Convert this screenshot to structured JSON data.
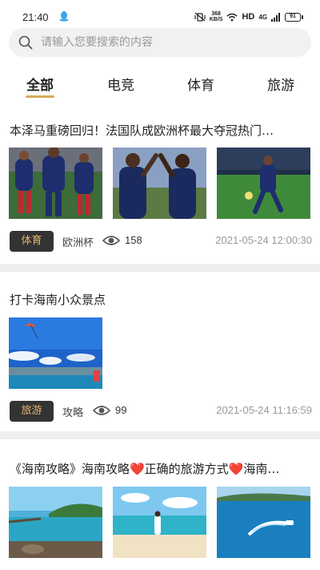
{
  "status_bar": {
    "time": "21:40",
    "net_speed_top": "368",
    "net_speed_unit": "KB/S",
    "hd": "HD",
    "signal": "4G",
    "battery": "91"
  },
  "search": {
    "placeholder": "请输入您要搜索的内容"
  },
  "tabs": [
    {
      "label": "全部",
      "active": true
    },
    {
      "label": "电竞",
      "active": false
    },
    {
      "label": "体育",
      "active": false
    },
    {
      "label": "旅游",
      "active": false
    }
  ],
  "feed": [
    {
      "title": "本泽马重磅回归！法国队成欧洲杯最大夺冠热门…",
      "tag": "体育",
      "category": "欧洲杯",
      "views": "158",
      "time": "2021-05-24 12:00:30",
      "image_count": 3
    },
    {
      "title": "打卡海南小众景点",
      "tag": "旅游",
      "category": "攻略",
      "views": "99",
      "time": "2021-05-24 11:16:59",
      "image_count": 1
    },
    {
      "title": "《海南攻略》海南攻略❤️正确的旅游方式❤️海南…",
      "image_count": 3
    }
  ],
  "colors": {
    "accent": "#d9a95c",
    "tag_bg": "#333333",
    "tag_text": "#e3b56c",
    "divider": "#eeeeee"
  }
}
